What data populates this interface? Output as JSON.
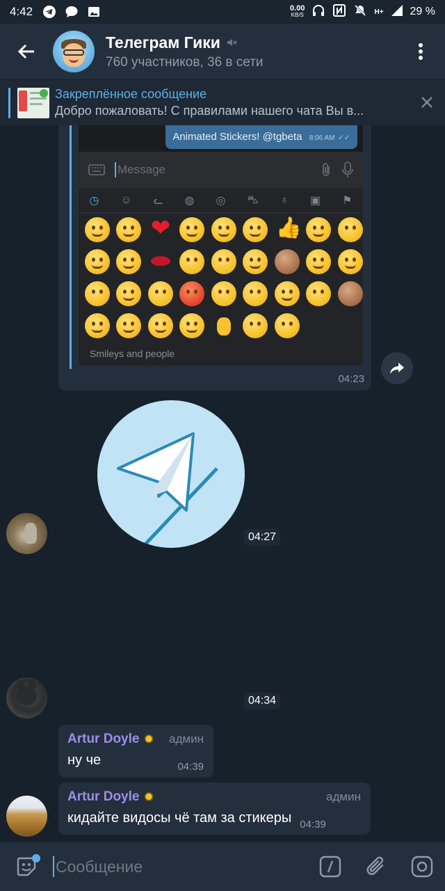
{
  "status_bar": {
    "time": "4:42",
    "net_speed": "0.00",
    "net_unit": "KB/S",
    "network": "H+",
    "battery": "29 %",
    "left_icons": [
      "telegram-icon",
      "chat-bubble-icon",
      "image-icon"
    ],
    "right_icons": [
      "headphones-icon",
      "nfc-icon",
      "mute-bell-icon",
      "signal-icon"
    ]
  },
  "header": {
    "title": "Телеграм Гики",
    "subtitle": "760 участников, 36 в сети",
    "muted_icon": "mute-icon",
    "back_icon": "arrow-left-icon",
    "menu_icon": "more-vertical-icon"
  },
  "pinned": {
    "title": "Закреплённое сообщение",
    "text": "Добро пожаловать! С правилами нашего чата Вы в...",
    "close_icon": "close-icon"
  },
  "messages": {
    "media": {
      "time": "04:23",
      "screenshot": {
        "sent_text": "Animated Stickers! @tgbeta",
        "sent_time": "8:06 AM",
        "compose_placeholder": "Message",
        "category_label": "Smileys and people"
      }
    },
    "sticker_time": "04:27",
    "second_time": "04:34",
    "msg1": {
      "author": "Artur Doyle",
      "badge": "✹",
      "role": "админ",
      "text": "ну че",
      "time": "04:39"
    },
    "msg2": {
      "author": "Artur Doyle",
      "badge": "✹",
      "role": "админ",
      "text": "кидайте видосы чё там за стикеры",
      "time": "04:39"
    }
  },
  "input": {
    "placeholder": "Сообщение",
    "icons": [
      "sticker-icon",
      "bot-command-icon",
      "paperclip-icon",
      "camera-icon"
    ]
  },
  "colors": {
    "background": "#17212b",
    "header": "#242f3d",
    "accent": "#5eaee8",
    "author_name": "#9a8fe8"
  }
}
